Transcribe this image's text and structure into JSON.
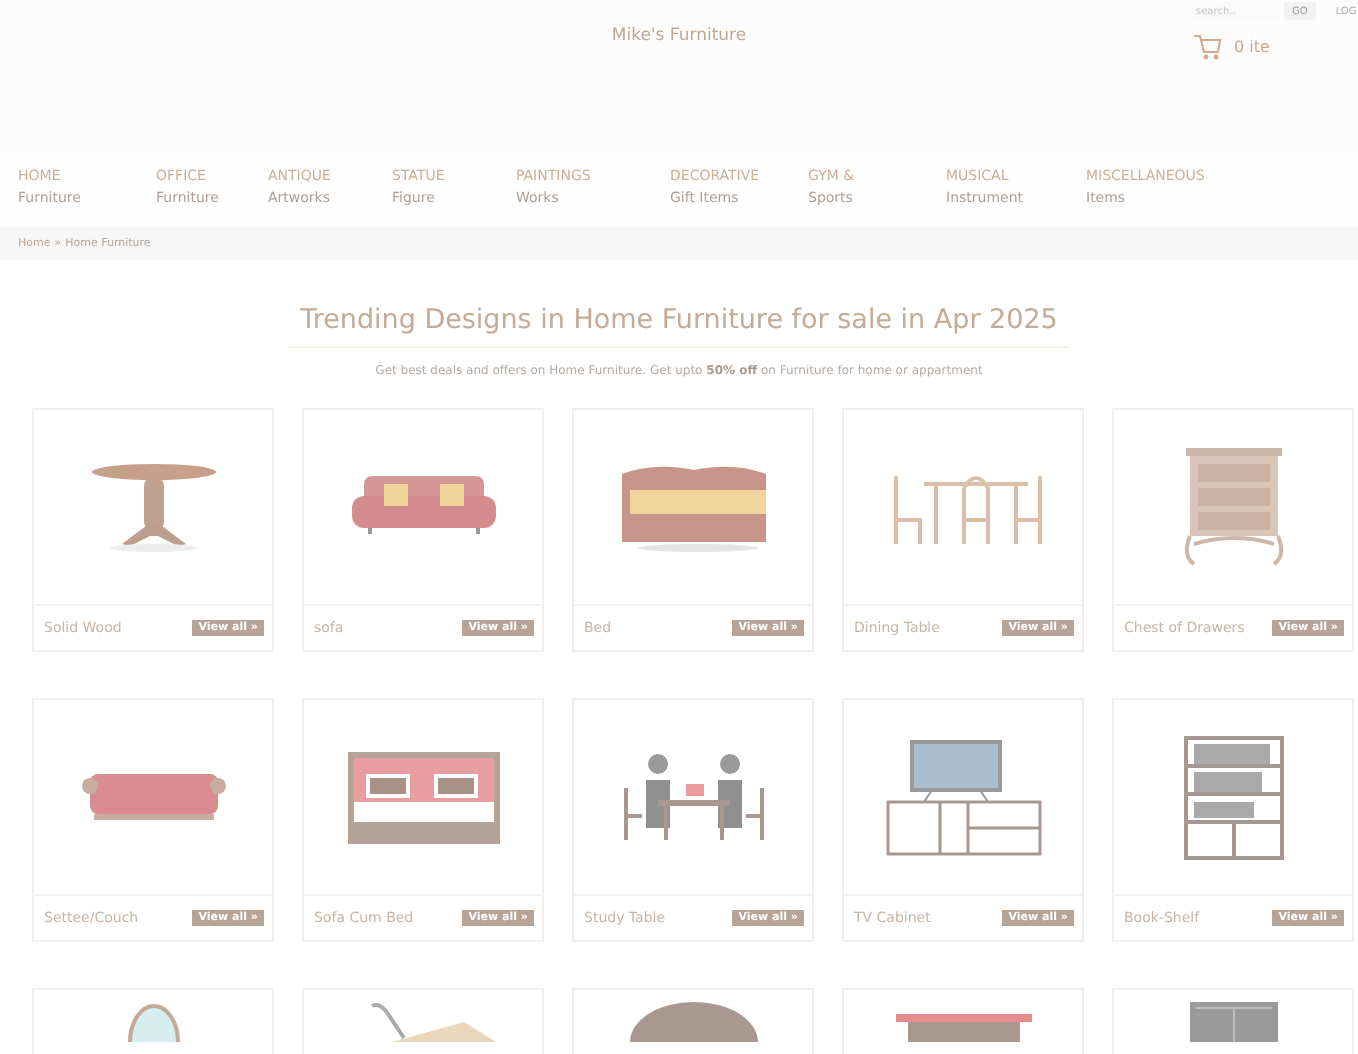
{
  "header": {
    "site_title": "Mike's Furniture",
    "search": {
      "placeholder": "search.."
    },
    "go_button": "GO",
    "login_link": "LOG",
    "cart_count": "0 ite"
  },
  "nav": [
    {
      "top": "HOME",
      "bottom": "Furniture"
    },
    {
      "top": "OFFICE",
      "bottom": "Furniture"
    },
    {
      "top": "ANTIQUE",
      "bottom": "Artworks"
    },
    {
      "top": "STATUE",
      "bottom": "Figure"
    },
    {
      "top": "PAINTINGS",
      "bottom": "Works"
    },
    {
      "top": "DECORATIVE",
      "bottom": "Gift Items"
    },
    {
      "top": "GYM &",
      "bottom": "Sports"
    },
    {
      "top": "MUSICAL",
      "bottom": "Instrument"
    },
    {
      "top": "MISCELLANEOUS",
      "bottom": "Items"
    }
  ],
  "breadcrumb": {
    "home": "Home",
    "separator": "»",
    "current": "Home Furniture"
  },
  "heading": "Trending Designs in Home Furniture for sale in Apr 2025",
  "subheading": "Get best deals and offers on Home Furniture. Get upto **50% off** on Furniture for home or appartment",
  "categories": [
    {
      "kind": "round-table",
      "label": "Solid Wood",
      "button": "View all »"
    },
    {
      "kind": "sofa",
      "label": "sofa",
      "button": "View all »"
    },
    {
      "kind": "bed",
      "label": "Bed",
      "button": "View all »"
    },
    {
      "kind": "dining",
      "label": "Dining Table",
      "button": "View all »"
    },
    {
      "kind": "drawers",
      "label": "Chest of Drawers",
      "button": "View all »"
    },
    {
      "kind": "couch",
      "label": "Settee/Couch",
      "button": "View all »"
    },
    {
      "kind": "sofa-bed",
      "label": "Sofa Cum Bed",
      "button": "View all »"
    },
    {
      "kind": "study",
      "label": "Study Table",
      "button": "View all »"
    },
    {
      "kind": "tv",
      "label": "TV Cabinet",
      "button": "View all »"
    },
    {
      "kind": "bookshelf",
      "label": "Book-Shelf",
      "button": "View all »"
    },
    {
      "kind": "mirror"
    },
    {
      "kind": "desk"
    },
    {
      "kind": "oval-table"
    },
    {
      "kind": "red-table"
    },
    {
      "kind": "cabinet"
    }
  ]
}
